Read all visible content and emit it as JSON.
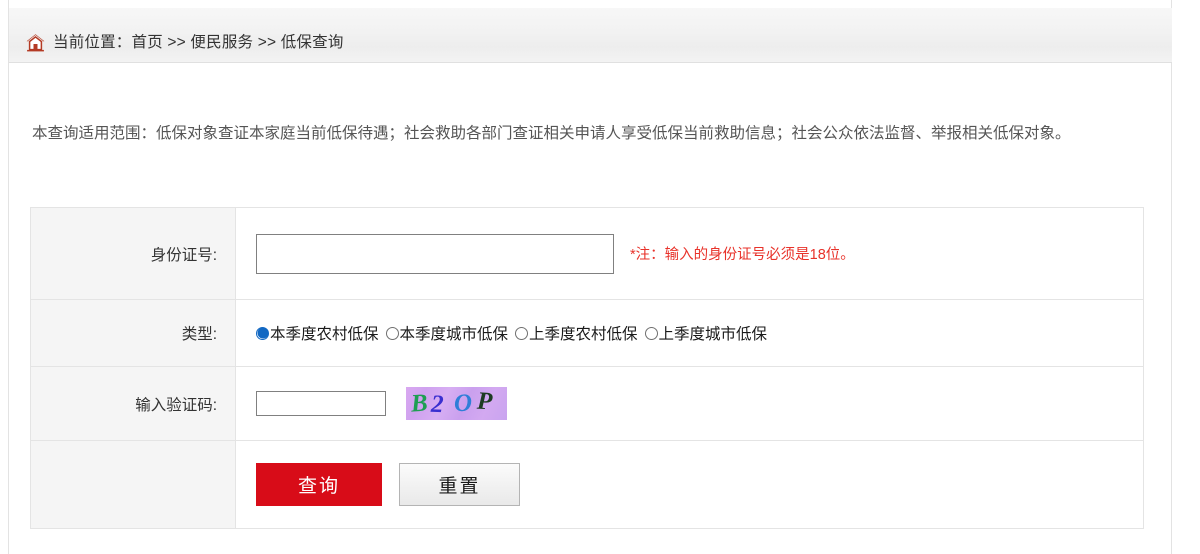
{
  "breadcrumb": {
    "home_icon": "home-icon",
    "text": "当前位置：首页 >> 便民服务 >> 低保查询"
  },
  "intro": {
    "text": "本查询适用范围：低保对象查证本家庭当前低保待遇；社会救助各部门查证相关申请人享受低保当前救助信息；社会公众依法监督、举报相关低保对象。"
  },
  "form": {
    "id_row": {
      "label": "身份证号:",
      "input_value": "",
      "input_placeholder": "",
      "note": "*注：输入的身份证号必须是18位。",
      "note_color": "#e8322a"
    },
    "type_row": {
      "label": "类型:",
      "options": [
        {
          "label": "本季度农村低保",
          "checked": true
        },
        {
          "label": "本季度城市低保",
          "checked": false
        },
        {
          "label": "上季度农村低保",
          "checked": false
        },
        {
          "label": "上季度城市低保",
          "checked": false
        }
      ],
      "accent_color": "#1268c3"
    },
    "captcha_row": {
      "label": "输入验证码:",
      "input_value": "",
      "input_placeholder": "",
      "captcha": {
        "text": "B2OP",
        "characters": [
          {
            "char": "B",
            "color": "#1e9e52"
          },
          {
            "char": "2",
            "color": "#3a2fd0"
          },
          {
            "char": "O",
            "color": "#2f7ed8"
          },
          {
            "char": "P",
            "color": "#1d3b22"
          }
        ],
        "background_color": "#d3a6f0"
      }
    },
    "actions_row": {
      "query_label": "查询",
      "query_color": "#d80c18",
      "reset_label": "重置"
    }
  }
}
